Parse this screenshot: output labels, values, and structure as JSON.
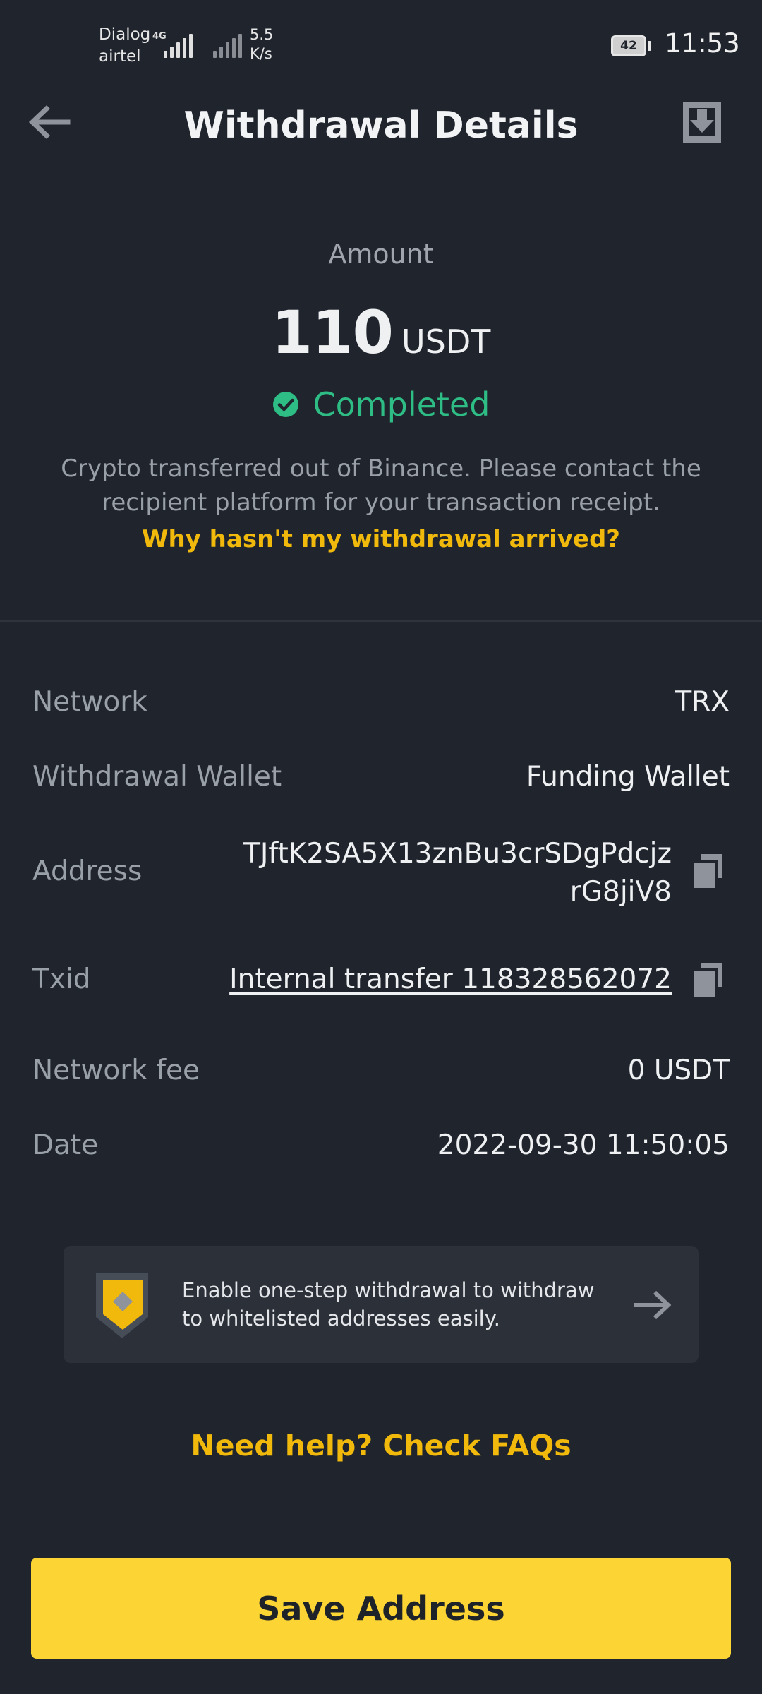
{
  "status_bar": {
    "carrier_1": "Dialog",
    "carrier_2": "airtel",
    "network_type": "4G",
    "speed_value": "5.5",
    "speed_unit": "K/s",
    "battery": "42",
    "time": "11:53"
  },
  "header": {
    "title": "Withdrawal Details",
    "back_icon": "arrow-left-icon",
    "download_icon": "download-icon"
  },
  "summary": {
    "amount_label": "Amount",
    "amount_value": "110",
    "amount_unit": "USDT",
    "status": "Completed",
    "status_color": "#2ebd85",
    "info": "Crypto transferred out of Binance. Please contact the recipient platform for your transaction receipt.",
    "help_link": "Why hasn't my withdrawal arrived?"
  },
  "details": {
    "network_label": "Network",
    "network_value": "TRX",
    "wallet_label": "Withdrawal Wallet",
    "wallet_value": "Funding Wallet",
    "address_label": "Address",
    "address_value": "TJftK2SA5X13znBu3crSDgPdcjzrG8jiV8",
    "txid_label": "Txid",
    "txid_value": "Internal transfer 118328562072",
    "fee_label": "Network fee",
    "fee_value": "0 USDT",
    "date_label": "Date",
    "date_value": "2022-09-30 11:50:05"
  },
  "banner": {
    "text": "Enable one-step withdrawal to withdraw to whitelisted addresses easily.",
    "icon": "shield-icon"
  },
  "faq_link": "Need help? Check FAQs",
  "save_button": "Save Address",
  "colors": {
    "background": "#1f242d",
    "accent": "#f0b90b",
    "button": "#fcd535"
  }
}
